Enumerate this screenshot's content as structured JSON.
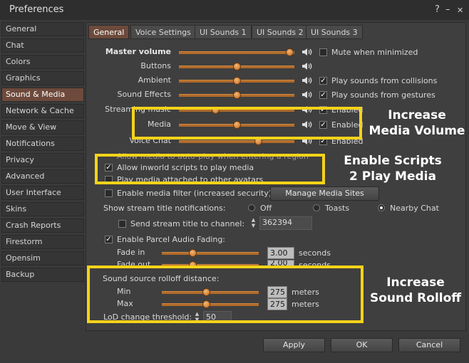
{
  "window": {
    "title": "Preferences",
    "help": "?",
    "minimize": "–",
    "close": "✕"
  },
  "sidebar": {
    "items": [
      {
        "label": "General"
      },
      {
        "label": "Chat"
      },
      {
        "label": "Colors"
      },
      {
        "label": "Graphics"
      },
      {
        "label": "Sound & Media",
        "active": true
      },
      {
        "label": "Network & Cache"
      },
      {
        "label": "Move & View"
      },
      {
        "label": "Notifications"
      },
      {
        "label": "Privacy"
      },
      {
        "label": "Advanced"
      },
      {
        "label": "User Interface"
      },
      {
        "label": "Skins"
      },
      {
        "label": "Crash Reports"
      },
      {
        "label": "Firestorm"
      },
      {
        "label": "Opensim"
      },
      {
        "label": "Backup"
      }
    ]
  },
  "tabs": [
    {
      "label": "General",
      "active": true
    },
    {
      "label": "Voice Settings"
    },
    {
      "label": "UI Sounds 1"
    },
    {
      "label": "UI Sounds 2"
    },
    {
      "label": "UI Sounds 3"
    }
  ],
  "volume": {
    "master": {
      "label": "Master volume",
      "level": 0.99,
      "check_label": "Mute when minimized",
      "checked": false
    },
    "rows": [
      {
        "label": "Buttons",
        "level": 0.5
      },
      {
        "label": "Ambient",
        "level": 0.5,
        "check_label": "Play sounds from collisions",
        "checked": true
      },
      {
        "label": "Sound Effects",
        "level": 0.5,
        "check_label": "Play sounds from gestures",
        "checked": true
      },
      {
        "label": "Streaming music",
        "level": 0.3,
        "check_label": "Enabled",
        "checked": true
      },
      {
        "label": "Media",
        "level": 0.5,
        "check_label": "Enabled",
        "checked": true
      },
      {
        "label": "Voice Chat",
        "level": 0.7,
        "check_label": "Enabled",
        "checked": true
      }
    ]
  },
  "media": {
    "auto_play": "Allow media to auto-play when entering a region",
    "allow_scripts": "Allow inworld scripts to play media",
    "attached": "Play media attached to other avatars",
    "filter": "Enable media filter (increased security)",
    "manage_button": "Manage Media Sites"
  },
  "stream": {
    "notifications_label": "Show stream title notifications:",
    "options": [
      "Off",
      "Toasts",
      "Nearby Chat"
    ],
    "selected": "Nearby Chat",
    "send_label": "Send stream title to channel:",
    "channel": "362394"
  },
  "parcel": {
    "label": "Enable Parcel Audio Fading:",
    "fade_in_label": "Fade in",
    "fade_in": "3.00",
    "fade_in_level": 0.3,
    "fade_out_label": "Fade out",
    "fade_out": "2.00",
    "fade_out_level": 0.3,
    "units": "seconds"
  },
  "rolloff": {
    "label": "Sound source rolloff distance:",
    "min_label": "Min",
    "min": "275",
    "min_level": 0.45,
    "max_label": "Max",
    "max": "275",
    "max_level": 0.45,
    "units": "meters",
    "lod_label": "LoD change threshold:",
    "lod": "50"
  },
  "buttons": {
    "apply": "Apply",
    "ok": "OK",
    "cancel": "Cancel"
  },
  "annotations": {
    "media_volume": [
      "Increase",
      "Media Volume"
    ],
    "scripts": [
      "Enable Scripts",
      "2 Play Media"
    ],
    "rolloff": [
      "Increase",
      "Sound Rolloff"
    ]
  },
  "colors": {
    "highlight": "#f4d319",
    "accent": "#6d4a3b",
    "slider": "#b06a2a"
  }
}
